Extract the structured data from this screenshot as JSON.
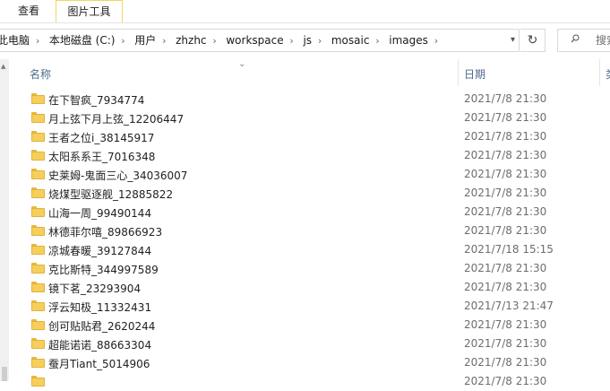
{
  "ribbon": {
    "tab_view": "查看",
    "tab_picture_tools": "图片工具"
  },
  "address": {
    "crumbs": [
      "此电脑",
      "本地磁盘 (C:)",
      "用户",
      "zhzhc",
      "workspace",
      "js",
      "mosaic",
      "images"
    ],
    "separator_icon": "chevron-right-icon",
    "dropdown_icon": "chevron-down-icon",
    "refresh_icon": "refresh-icon"
  },
  "search": {
    "label": "搜索",
    "icon": "search-icon"
  },
  "columns": {
    "name": "名称",
    "date": "日期",
    "type": "类"
  },
  "files": [
    {
      "name": "在下智疯_7934774",
      "date": "2021/7/8 21:30"
    },
    {
      "name": "月上弦下月上弦_12206447",
      "date": "2021/7/8 21:30"
    },
    {
      "name": "王者之位i_38145917",
      "date": "2021/7/8 21:30"
    },
    {
      "name": "太阳系系王_7016348",
      "date": "2021/7/8 21:30"
    },
    {
      "name": "史莱姆-鬼面三心_34036007",
      "date": "2021/7/8 21:30"
    },
    {
      "name": "烧煤型驱逐舰_12885822",
      "date": "2021/7/8 21:30"
    },
    {
      "name": "山海一周_99490144",
      "date": "2021/7/8 21:30"
    },
    {
      "name": "林德菲尔嘻_89866923",
      "date": "2021/7/8 21:30"
    },
    {
      "name": "凉城春暖_39127844",
      "date": "2021/7/18 15:15"
    },
    {
      "name": "克比斯特_344997589",
      "date": "2021/7/8 21:30"
    },
    {
      "name": "镜下茗_23293904",
      "date": "2021/7/8 21:30"
    },
    {
      "name": "浮云知极_11332431",
      "date": "2021/7/13 21:47"
    },
    {
      "name": "创可贴贴君_2620244",
      "date": "2021/7/8 21:30"
    },
    {
      "name": "超能诺诺_88663304",
      "date": "2021/7/8 21:30"
    },
    {
      "name": "蚕月Tiant_5014906",
      "date": "2021/7/8 21:30"
    },
    {
      "name": "",
      "date": "2021/7/8 21:30"
    }
  ]
}
